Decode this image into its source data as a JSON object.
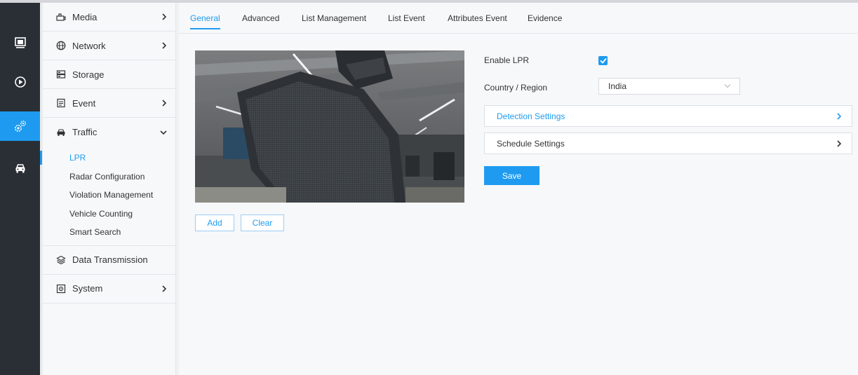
{
  "rail": {
    "items": [
      {
        "icon": "monitor-icon"
      },
      {
        "icon": "playback-icon"
      },
      {
        "icon": "settings-gears-icon",
        "active": true
      },
      {
        "icon": "vehicle-icon"
      }
    ]
  },
  "menu": {
    "items": [
      {
        "label": "Media",
        "icon": "media-icon",
        "chevron": "right"
      },
      {
        "label": "Network",
        "icon": "globe-icon",
        "chevron": "right"
      },
      {
        "label": "Storage",
        "icon": "storage-icon"
      },
      {
        "label": "Event",
        "icon": "event-icon",
        "chevron": "right"
      },
      {
        "label": "Traffic",
        "icon": "car-icon",
        "chevron": "down"
      },
      {
        "label": "Data Transmission",
        "icon": "layers-icon"
      },
      {
        "label": "System",
        "icon": "system-icon",
        "chevron": "right"
      }
    ],
    "traffic_sub": [
      {
        "label": "LPR",
        "active": true
      },
      {
        "label": "Radar Configuration"
      },
      {
        "label": "Violation Management"
      },
      {
        "label": "Vehicle Counting"
      },
      {
        "label": "Smart Search"
      }
    ]
  },
  "tabs": [
    {
      "label": "General",
      "active": true
    },
    {
      "label": "Advanced"
    },
    {
      "label": "List Management"
    },
    {
      "label": "List Event"
    },
    {
      "label": "Attributes Event"
    },
    {
      "label": "Evidence"
    }
  ],
  "preview": {
    "add_label": "Add",
    "clear_label": "Clear"
  },
  "form": {
    "enable_lpr_label": "Enable LPR",
    "enable_lpr_checked": true,
    "country_label": "Country / Region",
    "country_value": "India",
    "detection_settings_label": "Detection Settings",
    "schedule_settings_label": "Schedule Settings",
    "save_label": "Save"
  },
  "colors": {
    "accent": "#1e9bf0",
    "rail_bg": "#2a2f36"
  }
}
